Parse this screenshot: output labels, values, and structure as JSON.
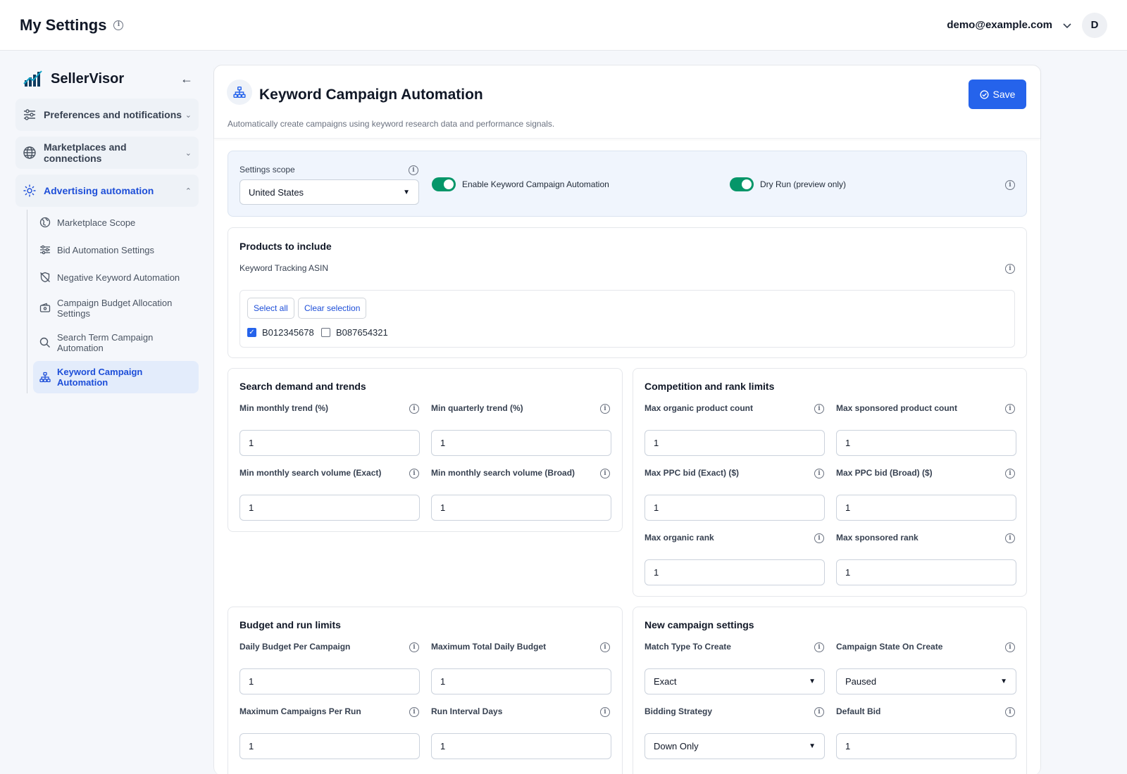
{
  "topbar": {
    "title": "My Settings",
    "email": "demo@example.com",
    "avatar": "D"
  },
  "sidebar": {
    "brand": "SellerVisor",
    "groups": [
      {
        "label": "Preferences and notifications",
        "icon": "sliders-icon"
      },
      {
        "label": "Marketplaces and connections",
        "icon": "globe-icon"
      },
      {
        "label": "Advertising automation",
        "icon": "gear-icon"
      }
    ],
    "items": [
      {
        "label": "Marketplace Scope",
        "icon": "globe-icon"
      },
      {
        "label": "Bid Automation Settings",
        "icon": "sliders-icon"
      },
      {
        "label": "Negative Keyword Automation",
        "icon": "shield-off-icon"
      },
      {
        "label": "Campaign Budget Allocation Settings",
        "icon": "wallet-icon"
      },
      {
        "label": "Search Term Campaign Automation",
        "icon": "search-icon"
      },
      {
        "label": "Keyword Campaign Automation",
        "icon": "network-icon"
      }
    ]
  },
  "header": {
    "title": "Keyword Campaign Automation",
    "subtitle": "Automatically create campaigns using keyword research data and performance signals.",
    "save_label": "Save"
  },
  "scope": {
    "label": "Settings scope",
    "value": "United States",
    "toggle1": "Enable Keyword Campaign Automation",
    "toggle2": "Dry Run (preview only)"
  },
  "products": {
    "title": "Products to include",
    "label": "Keyword Tracking ASIN",
    "select_all": "Select all",
    "clear": "Clear selection",
    "asins": [
      {
        "id": "B012345678",
        "checked": true
      },
      {
        "id": "B087654321",
        "checked": false
      }
    ]
  },
  "demand": {
    "title": "Search demand and trends",
    "f1": "Min monthly trend (%)",
    "v1": "1",
    "f2": "Min quarterly trend (%)",
    "v2": "1",
    "f3": "Min monthly search volume (Exact)",
    "v3": "1",
    "f4": "Min monthly search volume (Broad)",
    "v4": "1"
  },
  "competition": {
    "title": "Competition and rank limits",
    "f1": "Max organic product count",
    "v1": "1",
    "f2": "Max sponsored product count",
    "v2": "1",
    "f3": "Max PPC bid (Exact) ($)",
    "v3": "1",
    "f4": "Max PPC bid (Broad) ($)",
    "v4": "1",
    "f5": "Max organic rank",
    "v5": "1",
    "f6": "Max sponsored rank",
    "v6": "1"
  },
  "budget": {
    "title": "Budget and run limits",
    "f1": "Daily Budget Per Campaign",
    "v1": "1",
    "f2": "Maximum Total Daily Budget",
    "v2": "1",
    "f3": "Maximum Campaigns Per Run",
    "v3": "1",
    "f4": "Run Interval Days",
    "v4": "1"
  },
  "newcampaign": {
    "title": "New campaign settings",
    "f1": "Match Type To Create",
    "v1": "Exact",
    "f2": "Campaign State On Create",
    "v2": "Paused",
    "f3": "Bidding Strategy",
    "v3": "Down Only",
    "f4": "Default Bid",
    "v4": "1"
  },
  "colors": {
    "accent": "#2563eb",
    "toggle": "#059669"
  }
}
